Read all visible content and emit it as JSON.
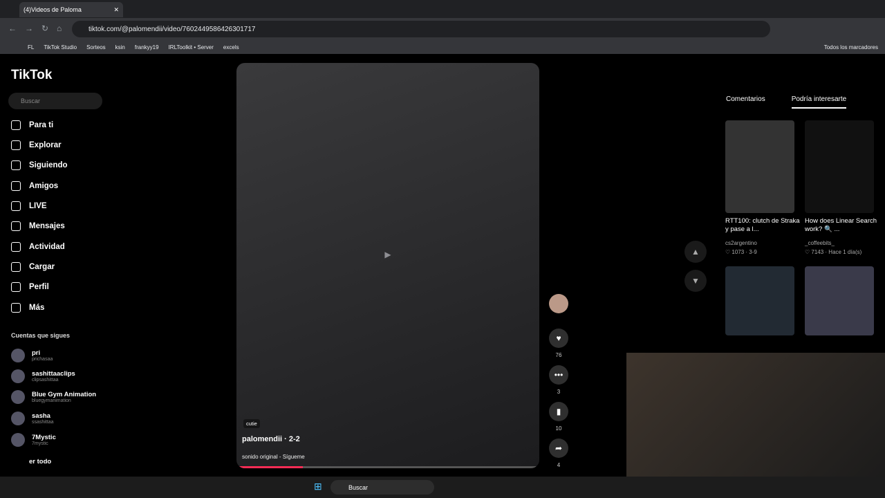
{
  "browser": {
    "tab_title": "(4)Videos de Paloma",
    "url": "tiktok.com/@palomendii/video/7602449586426301717",
    "bookmarks": [
      "FL",
      "TikTok Studio",
      "Sorteos",
      "ksin",
      "frankyy19",
      "IRLToolkit • Server",
      "excels"
    ],
    "all_bookmarks": "Todos los marcadores"
  },
  "sidebar": {
    "logo": "TikTok",
    "search_placeholder": "Buscar",
    "items": [
      "Para ti",
      "Explorar",
      "Siguiendo",
      "Amigos",
      "LIVE",
      "Mensajes",
      "Actividad",
      "Cargar",
      "Perfil",
      "Más"
    ],
    "following_title": "Cuentas que sigues",
    "following": [
      {
        "name": "pri",
        "user": "prichasaa"
      },
      {
        "name": "sashittaaclips",
        "user": "clipsashittaa"
      },
      {
        "name": "Blue Gym Animation",
        "user": "bluegymanimation"
      },
      {
        "name": "sasha",
        "user": "ssashittaa"
      },
      {
        "name": "7Mystic",
        "user": "7mystic"
      }
    ],
    "see_all": "er todo"
  },
  "video": {
    "tag": "cutie",
    "author": "palomendii · 2-2",
    "sound": "sonido original - Sígueme",
    "progress": 0.22
  },
  "actions": {
    "likes": "76",
    "comments": "3",
    "saves": "10",
    "shares": "4"
  },
  "right_panel": {
    "tabs": [
      "Comentarios",
      "Podría interesarte"
    ],
    "cards": [
      {
        "title": "RTT100: clutch de Straka y pase a l...",
        "author": "cs2argentino",
        "meta": "♡ 1073 · 3-9"
      },
      {
        "title": "How does Linear Search work? 🔍 ...",
        "author": "_coffeebits_",
        "meta": "♡ 7143 · Hace 1 día(s)"
      }
    ]
  },
  "taskbar": {
    "search": "Buscar"
  }
}
